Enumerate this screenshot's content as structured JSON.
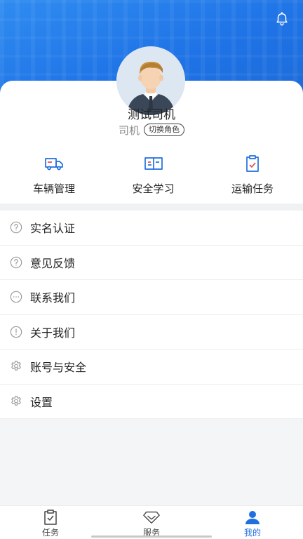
{
  "header": {
    "bell_icon": "bell-icon",
    "accent_color": "#1f73e6"
  },
  "profile": {
    "name": "测试司机",
    "role": "司机",
    "switch_role_label": "切换角色"
  },
  "quick_actions": [
    {
      "label": "车辆管理",
      "icon": "truck-icon"
    },
    {
      "label": "安全学习",
      "icon": "book-icon"
    },
    {
      "label": "运输任务",
      "icon": "clipboard-check-icon"
    }
  ],
  "menu": [
    {
      "label": "实名认证",
      "icon": "question-circle-icon"
    },
    {
      "label": "意见反馈",
      "icon": "question-circle-icon"
    },
    {
      "label": "联系我们",
      "icon": "chat-dots-icon"
    },
    {
      "label": "关于我们",
      "icon": "exclamation-circle-icon"
    },
    {
      "label": "账号与安全",
      "icon": "gear-icon"
    },
    {
      "label": "设置",
      "icon": "gear-icon"
    }
  ],
  "tabbar": {
    "active_color": "#1f6fe0",
    "tabs": [
      {
        "label": "任务",
        "icon": "clipboard-check-icon"
      },
      {
        "label": "服务",
        "icon": "diamond-icon"
      },
      {
        "label": "我的",
        "icon": "user-icon",
        "active": true
      }
    ]
  }
}
